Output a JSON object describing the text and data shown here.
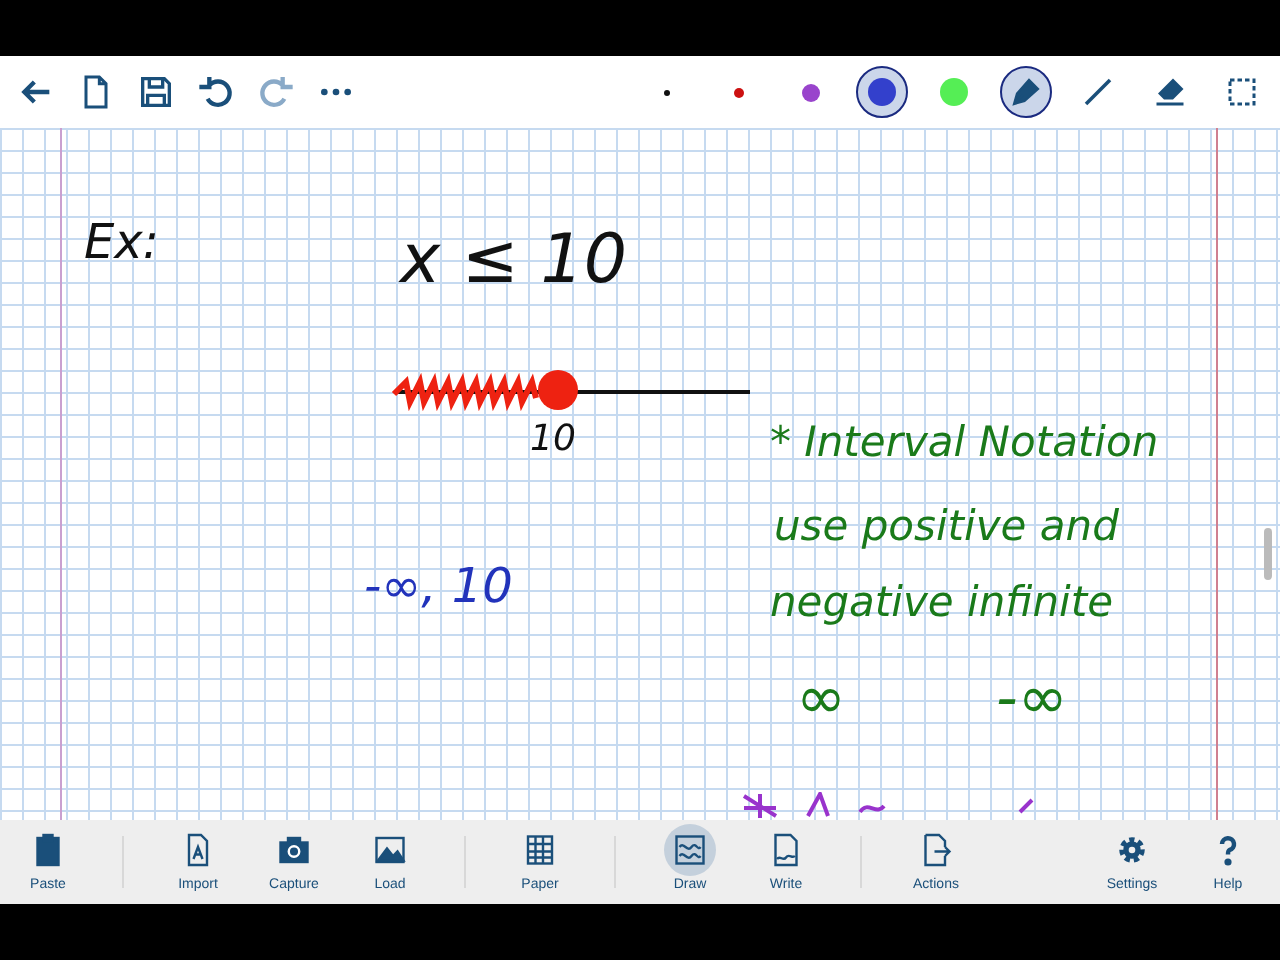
{
  "toolbar": {
    "actions": [
      {
        "kind": "back",
        "disabled": false
      },
      {
        "kind": "new",
        "disabled": false
      },
      {
        "kind": "save",
        "disabled": false
      },
      {
        "kind": "undo",
        "disabled": false
      },
      {
        "kind": "redo",
        "disabled": true
      },
      {
        "kind": "more",
        "disabled": false
      }
    ],
    "swatches": [
      {
        "color": "#111111",
        "selected": false
      },
      {
        "color": "#cc1111",
        "selected": false
      },
      {
        "color": "#9944cc",
        "selected": false
      },
      {
        "color": "#3340cc",
        "selected": true
      },
      {
        "color": "#55ee55",
        "selected": false
      }
    ],
    "tools": [
      {
        "kind": "pen",
        "selected": true
      },
      {
        "kind": "line",
        "selected": false
      },
      {
        "kind": "eraser",
        "selected": false
      },
      {
        "kind": "select",
        "selected": false
      }
    ]
  },
  "page": {
    "ink": [
      {
        "text": "Ex:",
        "color": "#111111"
      },
      {
        "text": "x ≤ 10",
        "color": "#111111"
      },
      {
        "text": "10",
        "color": "#111111"
      },
      {
        "text": "-∞, 10",
        "color": "#2233bb"
      },
      {
        "text": "* Interval Notation",
        "color": "#1a7a1a"
      },
      {
        "text": "use positive and",
        "color": "#1a7a1a"
      },
      {
        "text": "negative infinite",
        "color": "#1a7a1a"
      },
      {
        "text": "∞",
        "color": "#1a7a1a"
      },
      {
        "text": "-∞",
        "color": "#1a7a1a"
      }
    ]
  },
  "bottom_bar": {
    "groups": [
      [
        {
          "label": "Paste",
          "kind": "paste",
          "selected": false
        }
      ],
      [
        {
          "label": "Import",
          "kind": "import",
          "selected": false
        },
        {
          "label": "Capture",
          "kind": "capture",
          "selected": false
        },
        {
          "label": "Load",
          "kind": "load",
          "selected": false
        }
      ],
      [
        {
          "label": "Paper",
          "kind": "paper",
          "selected": false
        }
      ],
      [
        {
          "label": "Draw",
          "kind": "draw",
          "selected": true
        },
        {
          "label": "Write",
          "kind": "write",
          "selected": false
        }
      ],
      [
        {
          "label": "Actions",
          "kind": "actions",
          "selected": false
        }
      ],
      [
        {
          "label": "Settings",
          "kind": "settings",
          "selected": false
        },
        {
          "label": "Help",
          "kind": "help",
          "selected": false
        }
      ]
    ]
  }
}
